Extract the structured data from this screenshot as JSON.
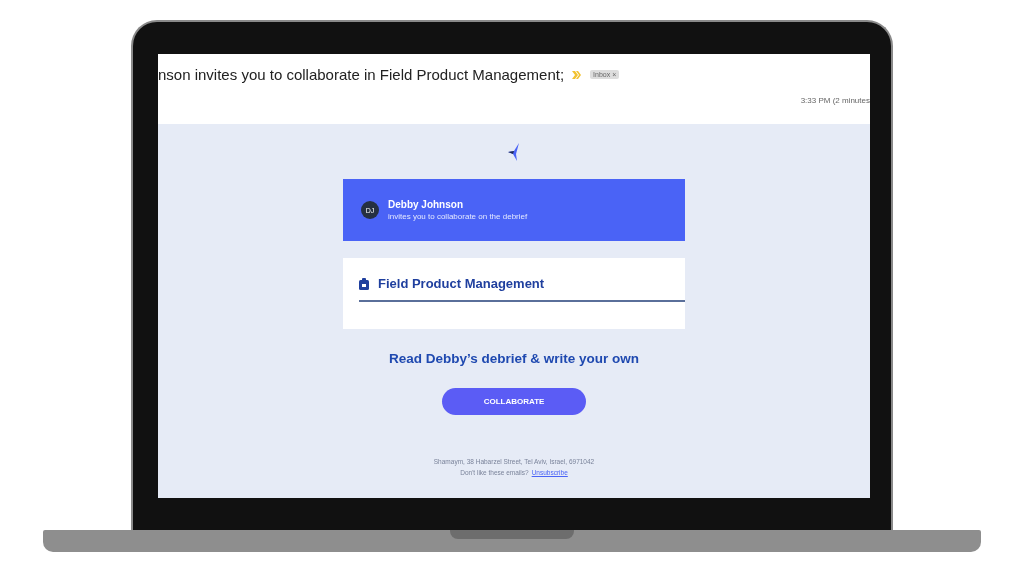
{
  "email_header": {
    "subject": "nson invites you to collaborate in Field Product Management;",
    "label": "Inbox",
    "label_close": "×",
    "time": "3:33 PM (2 minutes"
  },
  "invite_banner": {
    "avatar": "DJ",
    "name": "Debby Johnson",
    "message": "invites you to collaborate on the debrief"
  },
  "project_card": {
    "title": "Field Product Management"
  },
  "heading": "Read Debby’s debrief & write your own",
  "button": "COLLABORATE",
  "footer": {
    "address": "Shamaym, 38 Habarzel Street, Tel Aviv, Israel, 6971042",
    "prompt": "Don't like these emails?",
    "link": "Unsubscribe"
  }
}
